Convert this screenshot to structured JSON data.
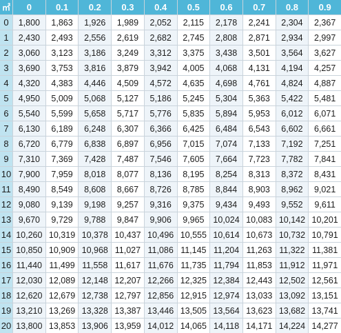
{
  "table": {
    "corner": "㎡",
    "columns": [
      "0",
      "0.1",
      "0.2",
      "0.3",
      "0.4",
      "0.5",
      "0.6",
      "0.7",
      "0.8",
      "0.9"
    ],
    "rows": [
      {
        "label": "0",
        "values": [
          "1,800",
          "1,863",
          "1,926",
          "1,989",
          "2,052",
          "2,115",
          "2,178",
          "2,241",
          "2,304",
          "2,367"
        ]
      },
      {
        "label": "1",
        "values": [
          "2,430",
          "2,493",
          "2,556",
          "2,619",
          "2,682",
          "2,745",
          "2,808",
          "2,871",
          "2,934",
          "2,997"
        ]
      },
      {
        "label": "2",
        "values": [
          "3,060",
          "3,123",
          "3,186",
          "3,249",
          "3,312",
          "3,375",
          "3,438",
          "3,501",
          "3,564",
          "3,627"
        ]
      },
      {
        "label": "3",
        "values": [
          "3,690",
          "3,753",
          "3,816",
          "3,879",
          "3,942",
          "4,005",
          "4,068",
          "4,131",
          "4,194",
          "4,257"
        ]
      },
      {
        "label": "4",
        "values": [
          "4,320",
          "4,383",
          "4,446",
          "4,509",
          "4,572",
          "4,635",
          "4,698",
          "4,761",
          "4,824",
          "4,887"
        ]
      },
      {
        "label": "5",
        "values": [
          "4,950",
          "5,009",
          "5,068",
          "5,127",
          "5,186",
          "5,245",
          "5,304",
          "5,363",
          "5,422",
          "5,481"
        ]
      },
      {
        "label": "6",
        "values": [
          "5,540",
          "5,599",
          "5,658",
          "5,717",
          "5,776",
          "5,835",
          "5,894",
          "5,953",
          "6,012",
          "6,071"
        ]
      },
      {
        "label": "7",
        "values": [
          "6,130",
          "6,189",
          "6,248",
          "6,307",
          "6,366",
          "6,425",
          "6,484",
          "6,543",
          "6,602",
          "6,661"
        ]
      },
      {
        "label": "8",
        "values": [
          "6,720",
          "6,779",
          "6,838",
          "6,897",
          "6,956",
          "7,015",
          "7,074",
          "7,133",
          "7,192",
          "7,251"
        ]
      },
      {
        "label": "9",
        "values": [
          "7,310",
          "7,369",
          "7,428",
          "7,487",
          "7,546",
          "7,605",
          "7,664",
          "7,723",
          "7,782",
          "7,841"
        ]
      },
      {
        "label": "10",
        "values": [
          "7,900",
          "7,959",
          "8,018",
          "8,077",
          "8,136",
          "8,195",
          "8,254",
          "8,313",
          "8,372",
          "8,431"
        ]
      },
      {
        "label": "11",
        "values": [
          "8,490",
          "8,549",
          "8,608",
          "8,667",
          "8,726",
          "8,785",
          "8,844",
          "8,903",
          "8,962",
          "9,021"
        ]
      },
      {
        "label": "12",
        "values": [
          "9,080",
          "9,139",
          "9,198",
          "9,257",
          "9,316",
          "9,375",
          "9,434",
          "9,493",
          "9,552",
          "9,611"
        ]
      },
      {
        "label": "13",
        "values": [
          "9,670",
          "9,729",
          "9,788",
          "9,847",
          "9,906",
          "9,965",
          "10,024",
          "10,083",
          "10,142",
          "10,201"
        ]
      },
      {
        "label": "14",
        "values": [
          "10,260",
          "10,319",
          "10,378",
          "10,437",
          "10,496",
          "10,555",
          "10,614",
          "10,673",
          "10,732",
          "10,791"
        ]
      },
      {
        "label": "15",
        "values": [
          "10,850",
          "10,909",
          "10,968",
          "11,027",
          "11,086",
          "11,145",
          "11,204",
          "11,263",
          "11,322",
          "11,381"
        ]
      },
      {
        "label": "16",
        "values": [
          "11,440",
          "11,499",
          "11,558",
          "11,617",
          "11,676",
          "11,735",
          "11,794",
          "11,853",
          "11,912",
          "11,971"
        ]
      },
      {
        "label": "17",
        "values": [
          "12,030",
          "12,089",
          "12,148",
          "12,207",
          "12,266",
          "12,325",
          "12,384",
          "12,443",
          "12,502",
          "12,561"
        ]
      },
      {
        "label": "18",
        "values": [
          "12,620",
          "12,679",
          "12,738",
          "12,797",
          "12,856",
          "12,915",
          "12,974",
          "13,033",
          "13,092",
          "13,151"
        ]
      },
      {
        "label": "19",
        "values": [
          "13,210",
          "13,269",
          "13,328",
          "13,387",
          "13,446",
          "13,505",
          "13,564",
          "13,623",
          "13,682",
          "13,741"
        ]
      },
      {
        "label": "20",
        "values": [
          "13,800",
          "13,853",
          "13,906",
          "13,959",
          "14,012",
          "14,065",
          "14,118",
          "14,171",
          "14,224",
          "14,277"
        ]
      }
    ]
  },
  "colors": {
    "header_bg": "#4fb6d8",
    "row_header_bg": "#bfe3f0",
    "cell_bg": "#eef4f9",
    "cell_alt_bg": "#ffffff"
  }
}
